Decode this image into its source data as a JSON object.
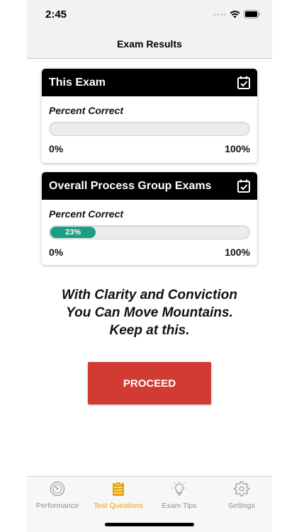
{
  "status_bar": {
    "time": "2:45"
  },
  "nav": {
    "title": "Exam Results"
  },
  "cards": [
    {
      "title": "This Exam",
      "label": "Percent Correct",
      "percent": 0,
      "fill_text": "",
      "min": "0%",
      "max": "100%"
    },
    {
      "title": "Overall Process Group Exams",
      "label": "Percent Correct",
      "percent": 23,
      "fill_text": "23%",
      "min": "0%",
      "max": "100%"
    }
  ],
  "message": {
    "line1": "With Clarity and Conviction",
    "line2": "You Can Move Mountains.",
    "line3": "Keep at this."
  },
  "proceed_button": {
    "label": "PROCEED",
    "color": "#d23b33"
  },
  "tabs": [
    {
      "label": "Performance",
      "icon": "gauge-icon",
      "active": false
    },
    {
      "label": "Test Questions",
      "icon": "clipboard-list-icon",
      "active": true
    },
    {
      "label": "Exam Tips",
      "icon": "lightbulb-icon",
      "active": false
    },
    {
      "label": "Settings",
      "icon": "gear-icon",
      "active": false
    }
  ],
  "colors": {
    "accent": "#e4a400",
    "progress": "#1a9e84",
    "header": "#000000"
  }
}
